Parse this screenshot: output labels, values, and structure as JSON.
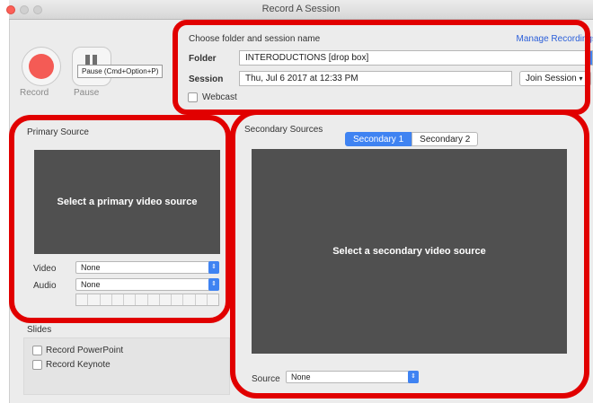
{
  "window": {
    "title": "Record A Session"
  },
  "controls": {
    "record_label": "Record",
    "pause_label": "Pause",
    "pause_tooltip": "Pause (Cmd+Option+P)"
  },
  "session_group": {
    "heading": "Choose folder and session name",
    "manage_link": "Manage Recordings",
    "folder_label": "Folder",
    "folder_value": "INTERODUCTIONS [drop box]",
    "session_label": "Session",
    "session_value": "Thu, Jul 6 2017 at 12:33 PM",
    "join_button": "Join Session",
    "webcast_label": "Webcast"
  },
  "primary": {
    "title": "Primary Source",
    "placeholder": "Select a primary video source",
    "video_label": "Video",
    "video_value": "None",
    "audio_label": "Audio",
    "audio_value": "None"
  },
  "secondary": {
    "title": "Secondary Sources",
    "tabs": [
      {
        "label": "Secondary 1"
      },
      {
        "label": "Secondary 2"
      }
    ],
    "active_tab": "Secondary 1",
    "placeholder": "Select a secondary video source",
    "source_label": "Source",
    "source_value": "None"
  },
  "slides": {
    "title": "Slides",
    "powerpoint_label": "Record PowerPoint",
    "keynote_label": "Record Keynote"
  },
  "colors": {
    "accent": "#3f83f2",
    "record": "#f45b55",
    "annotation": "#e10000",
    "video_bg": "#505050"
  }
}
